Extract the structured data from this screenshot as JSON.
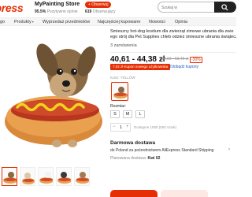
{
  "header": {
    "logo": "xpress",
    "store_name": "MyPainting Store",
    "store_rating": "95.5%",
    "store_rating_suffix": "Pozytywne opinie",
    "follow_label": "+ Obserwuj",
    "followers_count": "619",
    "followers_label": "Obserwujący",
    "search_placeholder": "Szukaj w",
    "search_icon": "search-icon"
  },
  "nav": {
    "items": [
      {
        "label": "go",
        "has_chevron": false
      },
      {
        "label": "Produkty",
        "has_chevron": true
      },
      {
        "label": "Wyprzedaż przedmiotów",
        "has_chevron": false
      },
      {
        "label": "Najczęściej kupowane",
        "has_chevron": false
      },
      {
        "label": "Nowości",
        "has_chevron": false
      },
      {
        "label": "Opinia",
        "has_chevron": false
      }
    ]
  },
  "product": {
    "title_line1": "Śmieszny hot-dog kostium dla zwierząt zimowe ubrania dla zwie",
    "title_line2": "ego strój dla Pet Supplies chleb odzież śmieszne ubrania świąteczne u",
    "orders": "3 zamówienia",
    "price": "40,61 - 44,38 zł",
    "old_price": "58,02 - 63,40 zł",
    "discount": "-30%",
    "coupon": "7,02 zł Kupon nowego użytkownika",
    "coupon_link": "Zdobądź kupony",
    "color_label": "Kolor: YELLOW",
    "size_label": "Rozmiar:",
    "sizes": [
      "S",
      "M",
      "L"
    ],
    "quantity": "1",
    "quantity_minus": "−",
    "quantity_plus": "+",
    "quantity_note": "Dostępne 1000 (500 sztuk)"
  },
  "shipping": {
    "title": "Darmowa dostawa",
    "line": "do Poland za pośrednictwem AliExpress Standard Shipping",
    "arrow": "›",
    "sub_prefix": "Planowana dostawa:",
    "sub_value": "Kwi 02"
  },
  "colors": {
    "accent": "#e62e04",
    "link": "#1f5fbf"
  }
}
